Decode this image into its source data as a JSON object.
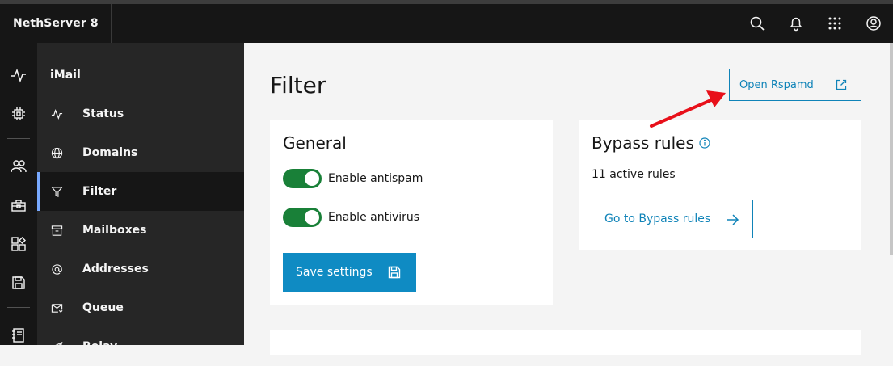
{
  "topbar": {
    "brand": "NethServer 8",
    "actions": [
      {
        "name": "search-icon"
      },
      {
        "name": "notification-icon"
      },
      {
        "name": "app-switcher-icon"
      },
      {
        "name": "user-avatar-icon"
      }
    ]
  },
  "rail": {
    "items": [
      {
        "name": "activity-icon"
      },
      {
        "name": "chip-icon"
      },
      {
        "name": "users-icon"
      },
      {
        "name": "toolbox-icon"
      },
      {
        "name": "apps-icon"
      },
      {
        "name": "save-icon"
      },
      {
        "name": "notebook-icon"
      }
    ]
  },
  "subnav": {
    "title": "iMail",
    "items": [
      {
        "label": "Status",
        "icon": "activity-icon"
      },
      {
        "label": "Domains",
        "icon": "globe-icon"
      },
      {
        "label": "Filter",
        "icon": "filter-icon",
        "active": true
      },
      {
        "label": "Mailboxes",
        "icon": "archive-icon"
      },
      {
        "label": "Addresses",
        "icon": "at-icon"
      },
      {
        "label": "Queue",
        "icon": "mail-queue-icon"
      },
      {
        "label": "Relay",
        "icon": "send-icon"
      }
    ]
  },
  "main": {
    "title": "Filter",
    "open_rspamd_label": "Open Rspamd",
    "general": {
      "title": "General",
      "antispam_label": "Enable antispam",
      "antispam_enabled": true,
      "antivirus_label": "Enable antivirus",
      "antivirus_enabled": true,
      "save_label": "Save settings"
    },
    "bypass": {
      "title": "Bypass rules",
      "count_text": "11 active rules",
      "goto_label": "Go to Bypass rules"
    }
  },
  "colors": {
    "accent": "#0f8bc3",
    "toggle_on": "#198038",
    "annotation_arrow": "#e8101a",
    "active_nav_border": "#78a9ff"
  }
}
